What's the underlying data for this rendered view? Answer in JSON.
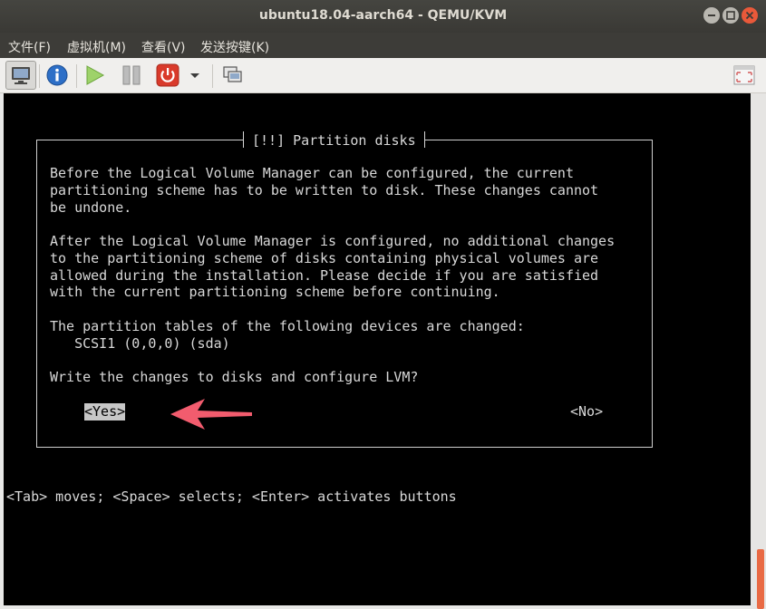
{
  "window": {
    "title": "ubuntu18.04-aarch64 - QEMU/KVM"
  },
  "menubar": {
    "items": [
      "文件(F)",
      "虚拟机(M)",
      "查看(V)",
      "发送按键(K)"
    ]
  },
  "toolbar": {
    "icons": [
      "console-icon",
      "info-icon",
      "run-icon",
      "pause-icon",
      "power-icon",
      "dropdown-arrow-icon",
      "snapshot-icon",
      "fullscreen-icon"
    ]
  },
  "dialog": {
    "title": "[!!] Partition disks",
    "paragraph1": "Before the Logical Volume Manager can be configured, the current\npartitioning scheme has to be written to disk. These changes cannot\nbe undone.",
    "paragraph2": "After the Logical Volume Manager is configured, no additional changes\nto the partitioning scheme of disks containing physical volumes are\nallowed during the installation. Please decide if you are satisfied\nwith the current partitioning scheme before continuing.",
    "paragraph3": "The partition tables of the following devices are changed:\n   SCSI1 (0,0,0) (sda)",
    "question": "Write the changes to disks and configure LVM?",
    "yes_label": "<Yes>",
    "no_label": "<No>"
  },
  "help_line": "<Tab> moves; <Space> selects; <Enter> activates buttons",
  "colors": {
    "annotation_arrow": "#f25c6e",
    "close_button": "#e9593a",
    "scroll_thumb": "#e96a44"
  }
}
